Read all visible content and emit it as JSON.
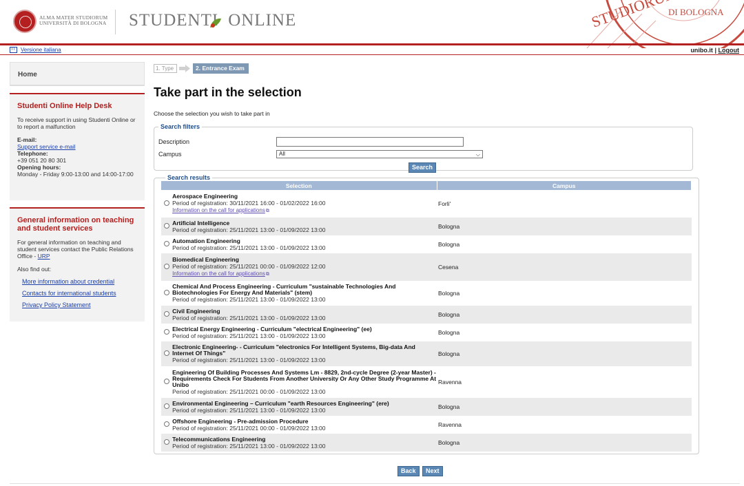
{
  "header": {
    "alma_line1": "ALMA MATER STUDIORUM",
    "alma_line2": "UNIVERSITÀ DI BOLOGNA",
    "brand_left": "STUDENTI",
    "brand_right": "ONLINE",
    "seal_text": "STUDIORUM",
    "seal_text2": "DI BOLOGNA"
  },
  "topbar": {
    "lang_icon": "IT",
    "lang_link": "Versione italiana",
    "site": "unibo.it",
    "separator": "|",
    "logout": "Logout"
  },
  "sidebar": {
    "home": "Home",
    "helpdesk": {
      "title": "Studenti Online Help Desk",
      "intro": "To receive support in using Studenti Online or to report a malfunction",
      "email_label": "E-mail:",
      "email_link": "Support service e-mail",
      "phone_label": "Telephone:",
      "phone": "+39 051 20 80 301",
      "hours_label": "Opening hours:",
      "hours": "Monday - Friday 9:00-13:00 and 14:00-17:00"
    },
    "info": {
      "title": "General information on teaching and student services",
      "text_prefix": "For general information on teaching and student services contact the Public Relations Office - ",
      "urp": "URP",
      "also": "Also find out:",
      "links": [
        "More information about credential",
        "Contacts for international students",
        "Privacy Policy Statement"
      ]
    }
  },
  "main": {
    "step1": "1. Type",
    "step2": "2. Entrance Exam",
    "title": "Take part in the selection",
    "subtitle": "Choose the selection you wish to take part in",
    "filters": {
      "legend": "Search filters",
      "description_label": "Description",
      "description_value": "",
      "campus_label": "Campus",
      "campus_value": "All",
      "search_button": "Search"
    },
    "results": {
      "legend": "Search results",
      "col_selection": "Selection",
      "col_campus": "Campus",
      "rows": [
        {
          "name": "Aerospace Engineering",
          "period": "Period of registration: 30/11/2021 16:00 - 01/02/2022 16:00",
          "info": "Information on the call for applications",
          "campus": "Forli'"
        },
        {
          "name": "Artificial Intelligence",
          "period": "Period of registration: 25/11/2021 13:00 - 01/09/2022 13:00",
          "info": "",
          "campus": "Bologna"
        },
        {
          "name": "Automation Engineering",
          "period": "Period of registration: 25/11/2021 13:00 - 01/09/2022 13:00",
          "info": "",
          "campus": "Bologna"
        },
        {
          "name": "Biomedical Engineering",
          "period": "Period of registration: 25/11/2021 00:00 - 01/09/2022 12:00",
          "info": "Information on the call for applications",
          "campus": "Cesena"
        },
        {
          "name": "Chemical And Process Engineering - Curriculum \"sustainable Technologies And Biotechnologies For Energy And Materials\" (stem)",
          "period": "Period of registration: 25/11/2021 13:00 - 01/09/2022 13:00",
          "info": "",
          "campus": "Bologna"
        },
        {
          "name": "Civil Engineering",
          "period": "Period of registration: 25/11/2021 13:00 - 01/09/2022 13:00",
          "info": "",
          "campus": "Bologna"
        },
        {
          "name": "Electrical Energy Engineering - Curriculum \"electrical Engineering\" (ee)",
          "period": "Period of registration: 25/11/2021 13:00 - 01/09/2022 13:00",
          "info": "",
          "campus": "Bologna"
        },
        {
          "name": "Electronic Engineering- - Curriculum \"electronics For Intelligent Systems, Big-data And Internet Of Things\"",
          "period": "Period of registration: 25/11/2021 13:00 - 01/09/2022 13:00",
          "info": "",
          "campus": "Bologna"
        },
        {
          "name": "Engineering Of Building Processes And Systems Lm - 8829, 2nd-cycle Degree (2-year Master) - Requirements Check For Students From Another University Or Any Other Study Programme At Unibo",
          "period": "Period of registration: 25/11/2021 00:00 - 01/09/2022 13:00",
          "info": "",
          "campus": "Ravenna"
        },
        {
          "name": "Environmental Engineering – Curriculum \"earth Resources Engineering\" (ere)",
          "period": "Period of registration: 25/11/2021 13:00 - 01/09/2022 13:00",
          "info": "",
          "campus": "Bologna"
        },
        {
          "name": "Offshore Engineering - Pre-admission Procedure",
          "period": "Period of registration: 25/11/2021 00:00 - 01/09/2022 13:00",
          "info": "",
          "campus": "Ravenna"
        },
        {
          "name": "Telecommunications Engineering",
          "period": "Period of registration: 25/11/2021 13:00 - 01/09/2022 13:00",
          "info": "",
          "campus": "Bologna"
        }
      ]
    },
    "back_button": "Back",
    "next_button": "Next"
  }
}
